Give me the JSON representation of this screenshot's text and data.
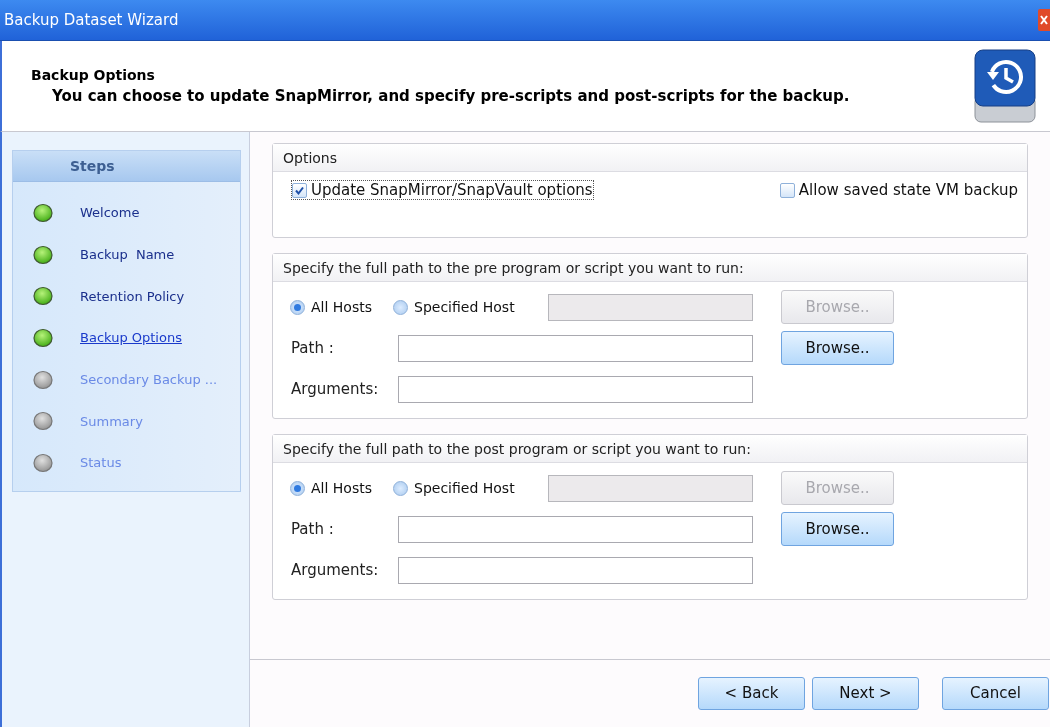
{
  "window": {
    "title": "Backup Dataset Wizard"
  },
  "header": {
    "title": "Backup Options",
    "subtitle": "You can choose to update SnapMirror, and specify pre-scripts and post-scripts for the backup."
  },
  "steps": {
    "title": "Steps",
    "items": [
      {
        "label": "Welcome",
        "completed": true,
        "selected": false
      },
      {
        "label": "Backup  Name",
        "completed": true,
        "selected": false
      },
      {
        "label": "Retention Policy",
        "completed": true,
        "selected": false
      },
      {
        "label": "Backup Options",
        "completed": true,
        "selected": true
      },
      {
        "label": "Secondary Backup ...",
        "completed": false,
        "selected": false
      },
      {
        "label": "Summary",
        "completed": false,
        "selected": false
      },
      {
        "label": "Status",
        "completed": false,
        "selected": false
      }
    ]
  },
  "options": {
    "title": "Options",
    "checkboxes": [
      {
        "label": "Update SnapMirror/SnapVault options",
        "checked": true
      },
      {
        "label": "Allow saved state VM backup",
        "checked": false
      }
    ]
  },
  "scripts": [
    {
      "title": "Specify the full path to the pre program or script you want to run:",
      "radios": [
        {
          "label": "All Hosts",
          "selected": true
        },
        {
          "label": "Specified Host",
          "selected": false
        }
      ],
      "host_browse": {
        "label": "Browse..",
        "disabled": true
      },
      "path_label": "Path :",
      "path_browse": {
        "label": "Browse..",
        "disabled": false
      },
      "arguments_label": "Arguments:"
    },
    {
      "title": "Specify the full path to the post program or script you want to run:",
      "radios": [
        {
          "label": "All Hosts",
          "selected": true
        },
        {
          "label": "Specified Host",
          "selected": false
        }
      ],
      "host_browse": {
        "label": "Browse..",
        "disabled": true
      },
      "path_label": "Path :",
      "path_browse": {
        "label": "Browse..",
        "disabled": false
      },
      "arguments_label": "Arguments:"
    }
  ],
  "buttons": [
    {
      "label": "< Back"
    },
    {
      "label": "Next >"
    },
    {
      "label": "Cancel"
    }
  ]
}
